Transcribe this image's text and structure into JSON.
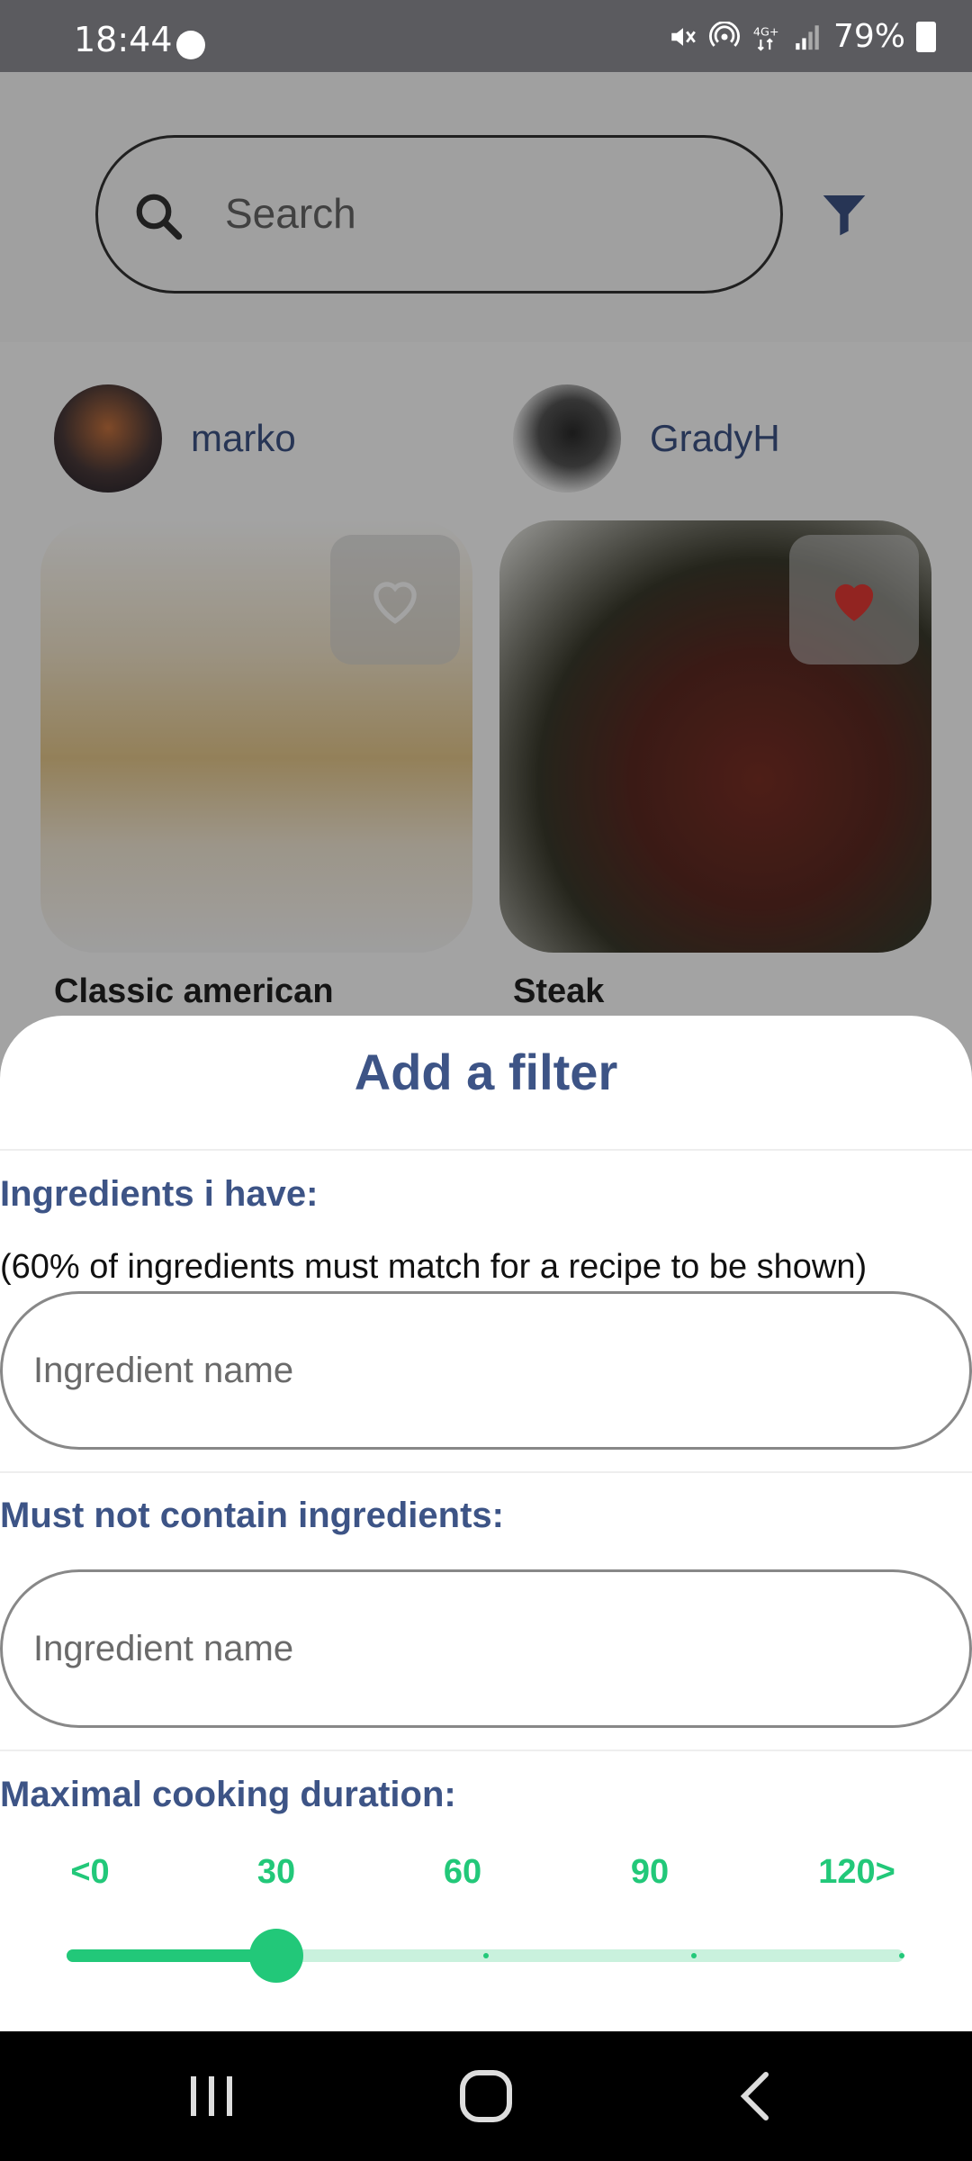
{
  "status_bar": {
    "time": "18:44",
    "battery": "79%",
    "icons": [
      "messenger-icon",
      "mute-icon",
      "hotspot-icon",
      "4g-icon",
      "signal-icon",
      "battery-icon"
    ]
  },
  "search": {
    "placeholder": "Search"
  },
  "recipes": [
    {
      "author": "marko",
      "title": "Classic american",
      "favorited": false
    },
    {
      "author": "GradyH",
      "title": "Steak",
      "favorited": true
    }
  ],
  "filter_sheet": {
    "title": "Add a filter",
    "have_label": "Ingredients i have:",
    "have_note": "(60% of ingredients must match for a recipe to be shown)",
    "have_placeholder": "Ingredient name",
    "exclude_label": "Must not contain ingredients:",
    "exclude_placeholder": "Ingredient name",
    "duration_label": "Maximal cooking duration:",
    "duration_ticks": [
      "<0",
      "30",
      "60",
      "90",
      "120>"
    ],
    "duration_min": 0,
    "duration_max": 120,
    "duration_value": 30
  },
  "colors": {
    "accent_green": "#22c879",
    "heading_blue": "#3d5486",
    "favorite_red": "#e53935"
  }
}
